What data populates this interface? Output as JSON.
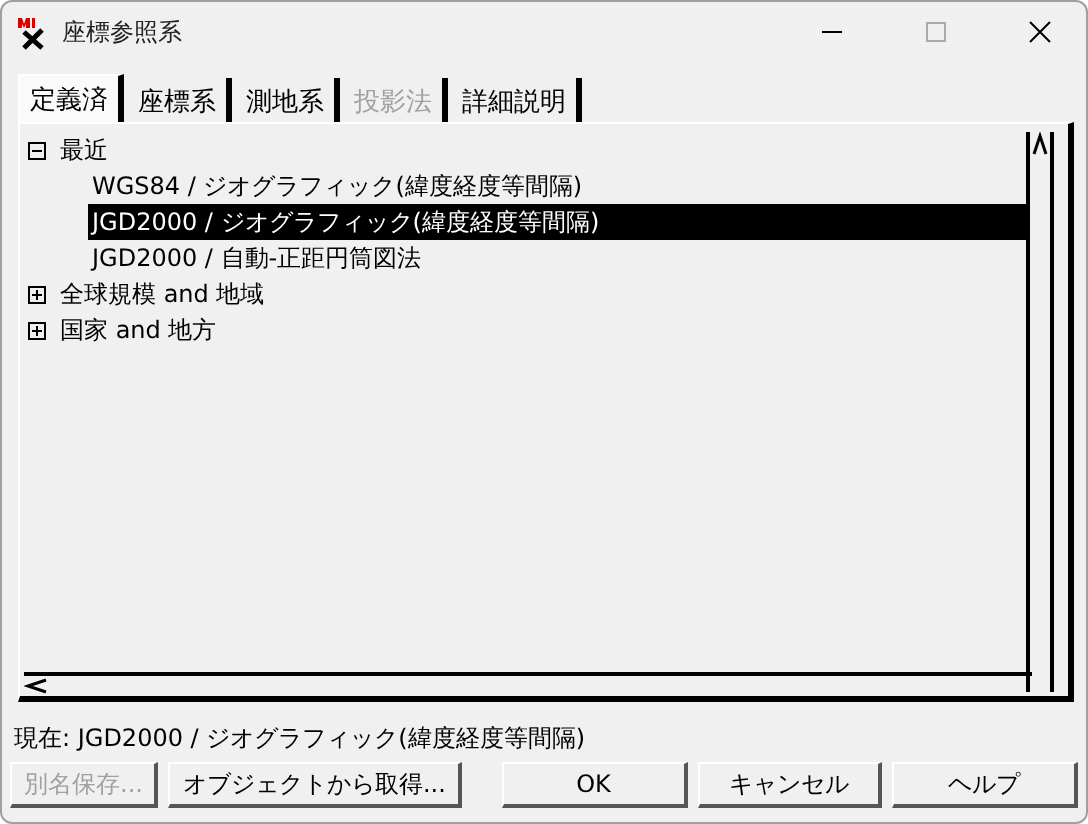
{
  "window": {
    "title": "座標参照系"
  },
  "tabs": [
    {
      "label": "定義済",
      "selected": true,
      "disabled": false
    },
    {
      "label": "座標系",
      "selected": false,
      "disabled": false
    },
    {
      "label": "測地系",
      "selected": false,
      "disabled": false
    },
    {
      "label": "投影法",
      "selected": false,
      "disabled": true
    },
    {
      "label": "詳細説明",
      "selected": false,
      "disabled": false
    }
  ],
  "tree": [
    {
      "label": "最近",
      "expanded": true,
      "selected": false,
      "children": [
        {
          "label": "WGS84 / ジオグラフィック(緯度経度等間隔)",
          "selected": false
        },
        {
          "label": "JGD2000 / ジオグラフィック(緯度経度等間隔)",
          "selected": true
        },
        {
          "label": "JGD2000 / 自動-正距円筒図法",
          "selected": false
        }
      ]
    },
    {
      "label": "全球規模 and 地域",
      "expanded": false,
      "selected": false
    },
    {
      "label": "国家 and 地方",
      "expanded": false,
      "selected": false
    }
  ],
  "current": "現在: JGD2000 / ジオグラフィック(緯度経度等間隔)",
  "buttons": [
    {
      "label": "別名保存...",
      "disabled": true
    },
    {
      "label": "オブジェクトから取得...",
      "disabled": false
    },
    {
      "label": "OK",
      "disabled": false
    },
    {
      "label": "キャンセル",
      "disabled": false
    },
    {
      "label": "ヘルプ",
      "disabled": false
    }
  ]
}
